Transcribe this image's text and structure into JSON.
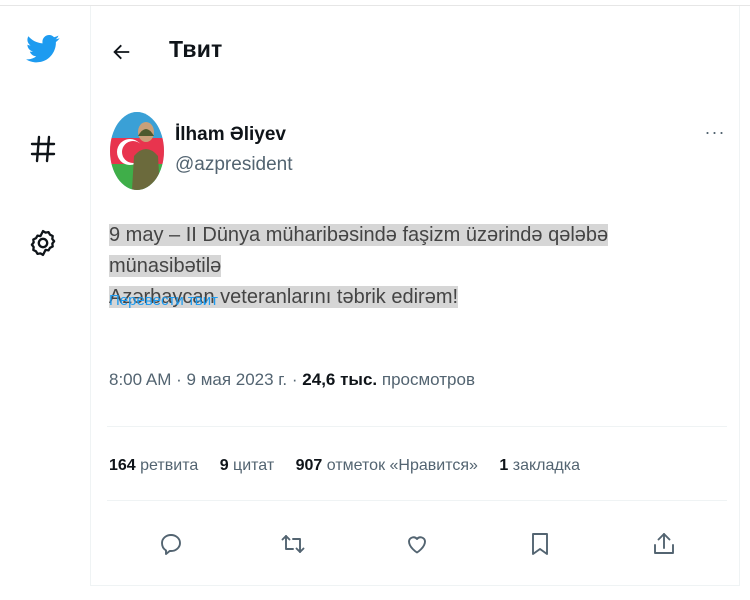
{
  "header": {
    "title": "Твит"
  },
  "sidebar": {
    "icons": [
      "twitter-logo-icon",
      "hashtag-icon",
      "gear-icon"
    ]
  },
  "tweet": {
    "author_name": "İlham Əliyev",
    "author_handle": "@azpresident",
    "more": "···",
    "text_line1": "9 may – II Dünya müharibəsində faşizm üzərində qələbə münasibətilə",
    "text_line2": "Azərbaycan veteranlarını təbrik edirəm!",
    "translate_label": "Перевести твит",
    "time": "8:00 AM",
    "date": "9 мая 2023 г.",
    "views_count": "24,6 тыс.",
    "views_label": "просмотров"
  },
  "stats": {
    "retweets_count": "164",
    "retweets_label": "ретвита",
    "quotes_count": "9",
    "quotes_label": "цитат",
    "likes_count": "907",
    "likes_label": "отметок «Нравится»",
    "bookmarks_count": "1",
    "bookmarks_label": "закладка"
  },
  "actions": [
    "reply-icon",
    "retweet-icon",
    "like-icon",
    "bookmark-icon",
    "share-icon"
  ],
  "colors": {
    "brand": "#1d9bf0",
    "text": "#0f1419",
    "secondary": "#536471",
    "highlight": "#d6d6d6"
  }
}
